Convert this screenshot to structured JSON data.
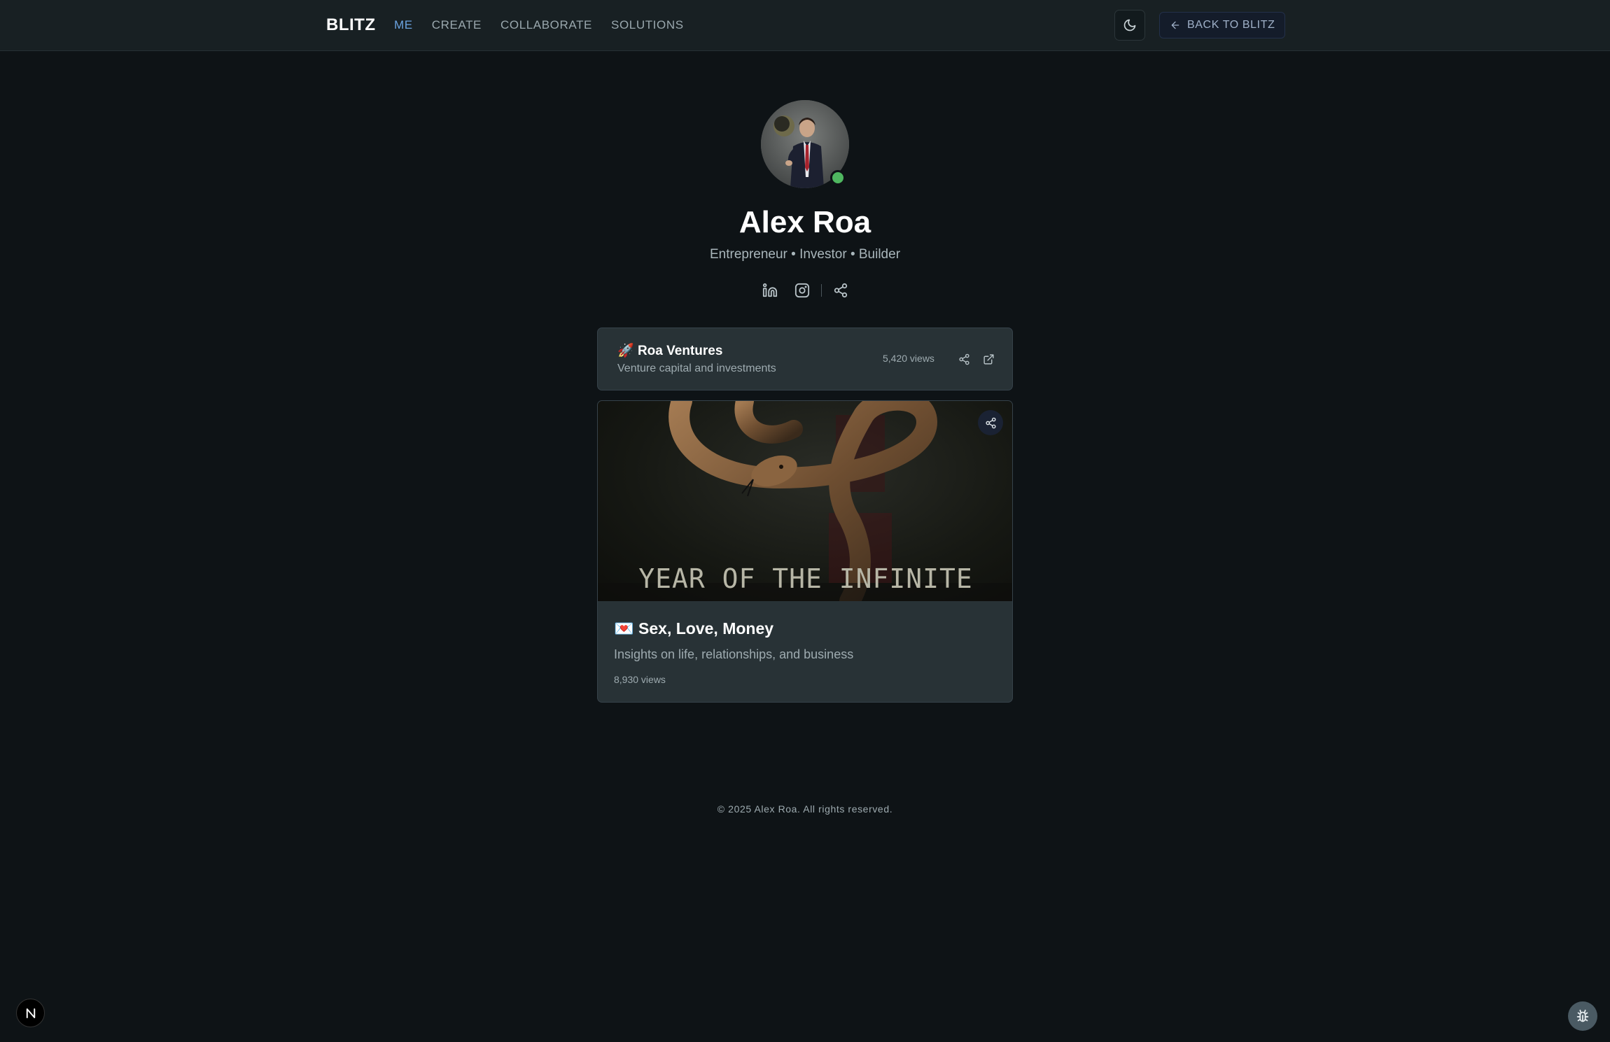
{
  "header": {
    "brand": "BLITZ",
    "nav": [
      {
        "label": "ME",
        "active": true
      },
      {
        "label": "CREATE",
        "active": false
      },
      {
        "label": "COLLABORATE",
        "active": false
      },
      {
        "label": "SOLUTIONS",
        "active": false
      }
    ],
    "theme_icon": "moon-icon",
    "back_label": "BACK TO BLITZ",
    "back_icon": "arrow-left-icon"
  },
  "profile": {
    "name": "Alex Roa",
    "tagline": "Entrepreneur • Investor • Builder",
    "status_color": "#4fb760",
    "socials": [
      {
        "icon": "linkedin-icon"
      },
      {
        "icon": "instagram-icon"
      },
      {
        "icon": "share-icon"
      }
    ]
  },
  "cards": [
    {
      "emoji": "🚀",
      "title": "Roa Ventures",
      "description": "Venture capital and investments",
      "views": "5,420 views"
    },
    {
      "emoji": "💌",
      "title": "Sex, Love, Money",
      "description": "Insights on life, relationships, and business",
      "views": "8,930 views",
      "cover_text": "YEAR OF THE INFINITE"
    }
  ],
  "footer": {
    "copyright": "© 2025 Alex Roa. All rights reserved."
  },
  "colors": {
    "background": "#0e1316",
    "header": "#182023",
    "card": "#283236",
    "accent": "#6ba3e0"
  }
}
